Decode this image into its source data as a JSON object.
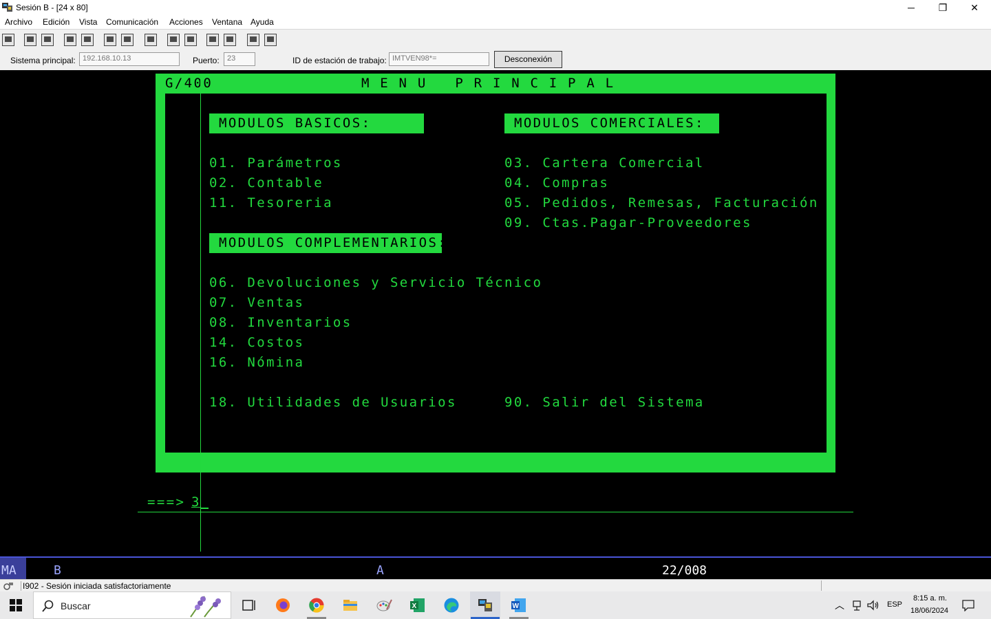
{
  "window": {
    "title": "Sesión B - [24 x 80]",
    "minimize_glyph": "─",
    "restore_glyph": "❐",
    "close_glyph": "✕"
  },
  "menu": [
    "Archivo",
    "Edición",
    "Vista",
    "Comunicación",
    "Acciones",
    "Ventana",
    "Ayuda"
  ],
  "connection": {
    "host_label": "Sistema principal:",
    "host_value": "192.168.10.13",
    "port_label": "Puerto:",
    "port_value": "23",
    "station_label": "ID de estación de trabajo:",
    "station_value": "IMTVEN98*=",
    "disconnect_label": "Desconexión"
  },
  "screen": {
    "system_id": "G/400",
    "title": "M E N U   P R I N C I P A L",
    "basic_header": "MODULOS BASICOS:",
    "commercial_header": "MODULOS COMERCIALES:",
    "complementary_header": "MODULOS COMPLEMENTARIOS:",
    "basic_items": [
      "01. Parámetros",
      "02. Contable",
      "11. Tesoreria"
    ],
    "commercial_items": [
      "03. Cartera Comercial",
      "04. Compras",
      "05. Pedidos, Remesas, Facturación",
      "09. Ctas.Pagar-Proveedores"
    ],
    "complementary_items": [
      "06. Devoluciones y Servicio Técnico",
      "07. Ventas",
      "08. Inventarios",
      "14. Costos",
      "16. Nómina"
    ],
    "utilities_item": "18. Utilidades de Usuarios",
    "exit_item": "90. Salir del Sistema",
    "prompt": "===>",
    "command_value": "3"
  },
  "oia": {
    "mode": "MA",
    "session": "B",
    "indicator": "A",
    "cursor_pos": "22/008"
  },
  "status_message": "I902 - Sesión iniciada satisfactoriamente",
  "taskbar": {
    "search_placeholder": "Buscar",
    "language": "ESP",
    "time": "8:15 a. m.",
    "date": "18/06/2024"
  },
  "colors": {
    "terminal_green": "#22d93e",
    "oia_blue": "#4a55d8"
  }
}
